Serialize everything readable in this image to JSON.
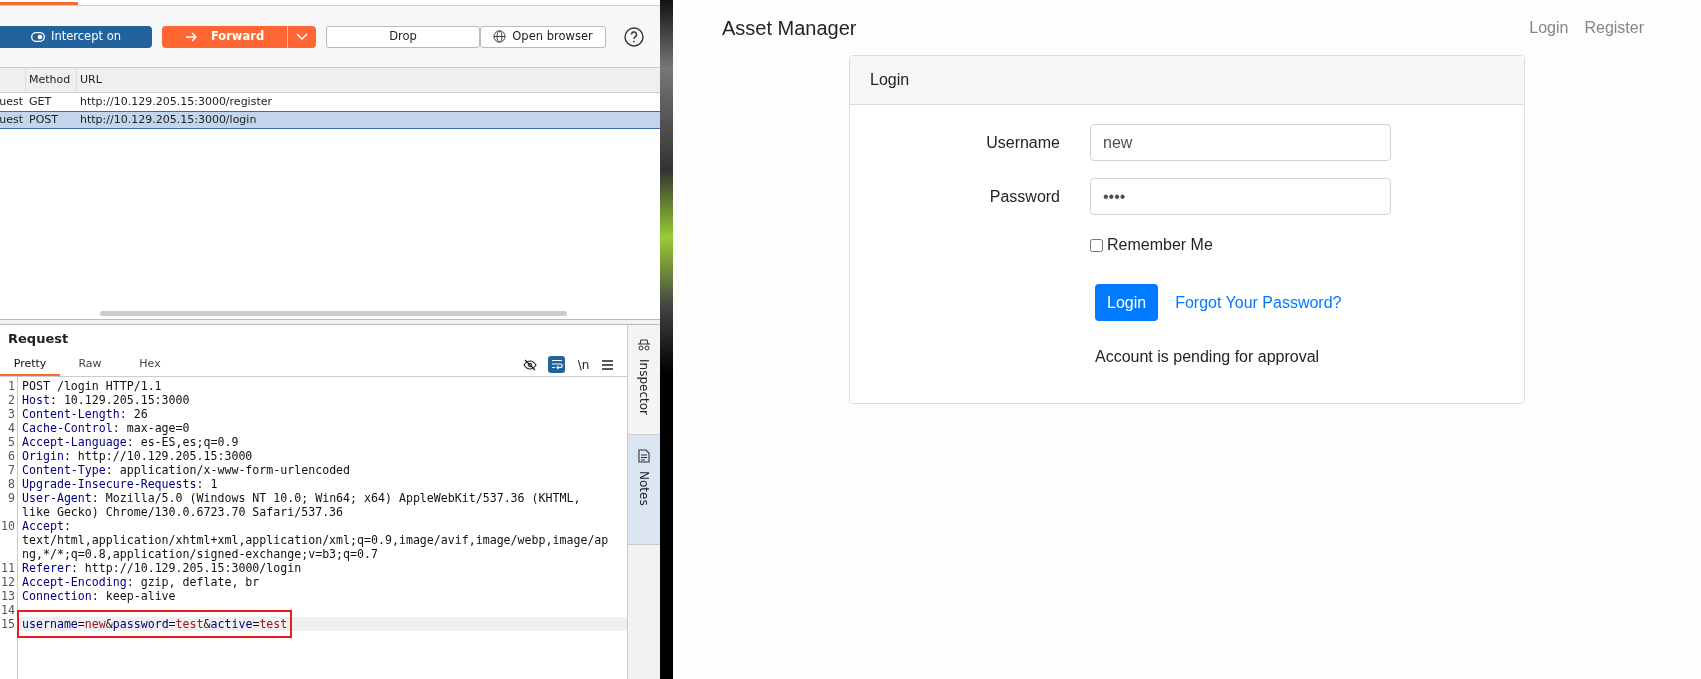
{
  "proxy": {
    "toolbar": {
      "intercept": {
        "label": "Intercept on",
        "on": true
      },
      "forward": {
        "label": "Forward"
      },
      "drop": {
        "label": "Drop"
      },
      "open_browser": {
        "label": "Open browser"
      }
    },
    "table": {
      "columns": [
        "Method",
        "URL"
      ],
      "rows": [
        {
          "column_1": "uest",
          "method": "GET",
          "url": "http://10.129.205.15:3000/register",
          "selected": false
        },
        {
          "column_1": "uest",
          "method": "POST",
          "url": "http://10.129.205.15:3000/login",
          "selected": true
        }
      ]
    },
    "request": {
      "title": "Request",
      "tabs": [
        {
          "label": "Pretty",
          "selected": true
        },
        {
          "label": "Raw",
          "selected": false
        },
        {
          "label": "Hex",
          "selected": false
        }
      ],
      "toggles": [
        {
          "kind": "eye",
          "on": false
        },
        {
          "kind": "wrap",
          "on": true
        },
        {
          "kind": "newline",
          "label": "\\n",
          "on": false
        }
      ],
      "lines": [
        {
          "number": "1",
          "current": false,
          "outlined": false,
          "segments": [
            {
              "kind": "plain",
              "text": "POST /login HTTP/1.1"
            }
          ]
        },
        {
          "number": "2",
          "current": false,
          "outlined": false,
          "segments": [
            {
              "kind": "key",
              "text": "Host"
            },
            {
              "kind": "plain",
              "text": ": 10.129.205.15:3000"
            }
          ]
        },
        {
          "number": "3",
          "current": false,
          "outlined": false,
          "segments": [
            {
              "kind": "key",
              "text": "Content-Length"
            },
            {
              "kind": "plain",
              "text": ": 26"
            }
          ]
        },
        {
          "number": "4",
          "current": false,
          "outlined": false,
          "segments": [
            {
              "kind": "key",
              "text": "Cache-Control"
            },
            {
              "kind": "plain",
              "text": ": max-age=0"
            }
          ]
        },
        {
          "number": "5",
          "current": false,
          "outlined": false,
          "segments": [
            {
              "kind": "key",
              "text": "Accept-Language"
            },
            {
              "kind": "plain",
              "text": ": es-ES,es;q=0.9"
            }
          ]
        },
        {
          "number": "6",
          "current": false,
          "outlined": false,
          "segments": [
            {
              "kind": "key",
              "text": "Origin"
            },
            {
              "kind": "plain",
              "text": ": http://10.129.205.15:3000"
            }
          ]
        },
        {
          "number": "7",
          "current": false,
          "outlined": false,
          "segments": [
            {
              "kind": "key",
              "text": "Content-Type"
            },
            {
              "kind": "plain",
              "text": ": application/x-www-form-urlencoded"
            }
          ]
        },
        {
          "number": "8",
          "current": false,
          "outlined": false,
          "segments": [
            {
              "kind": "key",
              "text": "Upgrade-Insecure-Requests"
            },
            {
              "kind": "plain",
              "text": ": 1"
            }
          ]
        },
        {
          "number": "9",
          "current": false,
          "outlined": false,
          "segments": [
            {
              "kind": "key",
              "text": "User-Agent"
            },
            {
              "kind": "plain",
              "text": ": Mozilla/5.0 (Windows NT 10.0; Win64; x64) AppleWebKit/537.36 (KHTML, like Gecko) Chrome/130.0.6723.70 Safari/537.36"
            }
          ]
        },
        {
          "number": "10",
          "current": false,
          "outlined": false,
          "segments": [
            {
              "kind": "key",
              "text": "Accept"
            },
            {
              "kind": "plain",
              "text": ": text/html,application/xhtml+xml,application/xml;q=0.9,image/avif,image/webp,image/apng,*/*;q=0.8,application/signed-exchange;v=b3;q=0.7"
            }
          ]
        },
        {
          "number": "11",
          "current": false,
          "outlined": false,
          "segments": [
            {
              "kind": "key",
              "text": "Referer"
            },
            {
              "kind": "plain",
              "text": ": http://10.129.205.15:3000/login"
            }
          ]
        },
        {
          "number": "12",
          "current": false,
          "outlined": false,
          "segments": [
            {
              "kind": "key",
              "text": "Accept-Encoding"
            },
            {
              "kind": "plain",
              "text": ": gzip, deflate, br"
            }
          ]
        },
        {
          "number": "13",
          "current": false,
          "outlined": false,
          "segments": [
            {
              "kind": "key",
              "text": "Connection"
            },
            {
              "kind": "plain",
              "text": ": keep-alive"
            }
          ]
        },
        {
          "number": "14",
          "current": false,
          "outlined": false
        },
        {
          "number": "15",
          "current": true,
          "outlined": true,
          "segments": [
            {
              "kind": "key",
              "text": "username"
            },
            {
              "kind": "plain",
              "text": "="
            },
            {
              "kind": "value",
              "text": "new"
            },
            {
              "kind": "plain",
              "text": "&"
            },
            {
              "kind": "key",
              "text": "password"
            },
            {
              "kind": "plain",
              "text": "="
            },
            {
              "kind": "value",
              "text": "test"
            },
            {
              "kind": "plain",
              "text": "&"
            },
            {
              "kind": "key",
              "text": "active"
            },
            {
              "kind": "plain",
              "text": "="
            },
            {
              "kind": "value",
              "text": "test"
            }
          ]
        }
      ]
    },
    "side_tabs": [
      {
        "kind": "inspector",
        "label": "Inspector",
        "selected": false
      },
      {
        "kind": "notes",
        "label": "Notes",
        "selected": true
      }
    ]
  },
  "browser": {
    "brand": "Asset Manager",
    "nav": [
      "Login",
      "Register"
    ],
    "card": {
      "title": "Login",
      "fields": [
        {
          "label": "Username",
          "value": "new"
        },
        {
          "label": "Password",
          "value": "••••"
        }
      ],
      "remember": {
        "label": "Remember Me",
        "checked": false
      },
      "submit": "Login",
      "forgot_link": "Forgot Your Password?",
      "message": "Account is pending for approval"
    }
  }
}
